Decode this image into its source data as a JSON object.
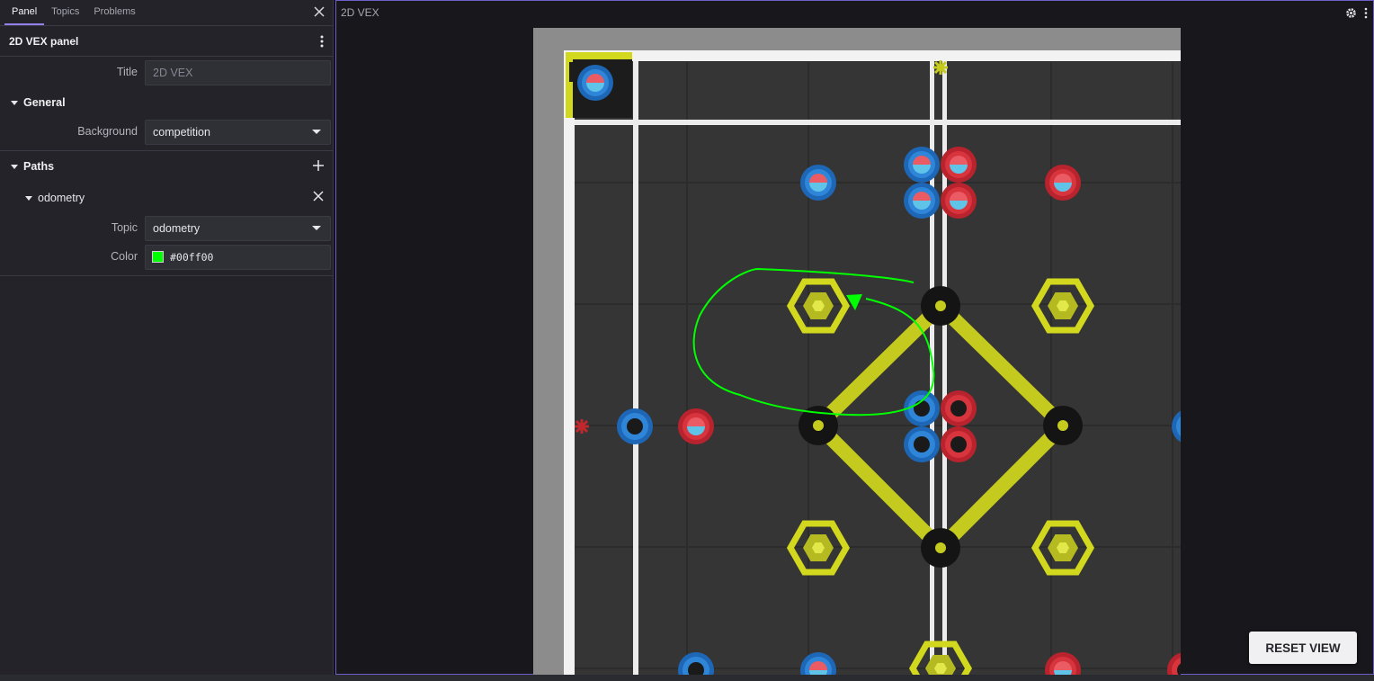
{
  "sidebar": {
    "tabs": [
      "Panel",
      "Topics",
      "Problems"
    ],
    "panel_title": "2D VEX panel",
    "title_label": "Title",
    "title_placeholder": "2D VEX",
    "general_label": "General",
    "background_label": "Background",
    "background_value": "competition",
    "paths_label": "Paths",
    "path_name": "odometry",
    "topic_label": "Topic",
    "topic_value": "odometry",
    "color_label": "Color",
    "color_value": "#00ff00"
  },
  "main": {
    "title": "2D VEX",
    "reset_label": "RESET VIEW",
    "path_color": "#00ff00",
    "accent": "#6c5fc7"
  }
}
